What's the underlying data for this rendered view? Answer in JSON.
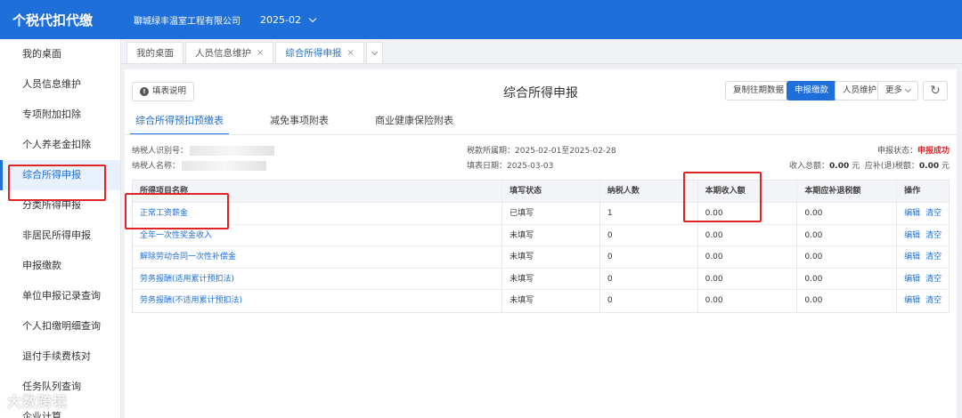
{
  "header": {
    "app_title": "个税代扣代缴",
    "company": "聊城绿丰温室工程有限公司",
    "period": "2025-02"
  },
  "sidebar": {
    "items": [
      {
        "label": "我的桌面"
      },
      {
        "label": "人员信息维护"
      },
      {
        "label": "专项附加扣除"
      },
      {
        "label": "个人养老金扣除"
      },
      {
        "label": "综合所得申报",
        "active": true
      },
      {
        "label": "分类所得申报"
      },
      {
        "label": "非居民所得申报"
      },
      {
        "label": "申报缴款"
      },
      {
        "label": "单位申报记录查询"
      },
      {
        "label": "个人扣缴明细查询"
      },
      {
        "label": "退付手续费核对"
      },
      {
        "label": "任务队列查询"
      },
      {
        "label": "企业计算"
      }
    ]
  },
  "watermark": "大数跨境",
  "page_tabs": [
    {
      "label": "我的桌面",
      "closable": false
    },
    {
      "label": "人员信息维护",
      "closable": true
    },
    {
      "label": "综合所得申报",
      "closable": true,
      "active": true
    }
  ],
  "toolbar": {
    "guide_label": "填表说明",
    "page_title": "综合所得申报",
    "copy_label": "复制往期数据",
    "declare_label": "申报缴款",
    "person_label": "人员维护",
    "more_label": "更多"
  },
  "sub_tabs": [
    {
      "label": "综合所得预扣预缴表",
      "active": true
    },
    {
      "label": "减免事项附表"
    },
    {
      "label": "商业健康保险附表"
    }
  ],
  "meta": {
    "taxpayer_id_label": "纳税人识别号：",
    "taxpayer_name_label": "纳税人名称：",
    "period_label": "税款所属期：",
    "period_value": "2025-02-01至2025-02-28",
    "fill_date_label": "填表日期：",
    "fill_date_value": "2025-03-03",
    "status_label": "申报状态：",
    "status_value": "申报成功",
    "income_total_label": "收入总额：",
    "income_total_value": "0.00",
    "tax_due_label": "应补(退)税额：",
    "tax_due_value": "0.00",
    "unit": "元"
  },
  "table": {
    "headers": [
      "所得项目名称",
      "填写状态",
      "纳税人数",
      "本期收入额",
      "本期应补退税额",
      "操作"
    ],
    "rows": [
      {
        "name": "正常工资薪金",
        "status": "已填写",
        "count": "1",
        "income": "0.00",
        "tax": "0.00"
      },
      {
        "name": "全年一次性奖金收入",
        "status": "未填写",
        "count": "0",
        "income": "0.00",
        "tax": "0.00"
      },
      {
        "name": "解除劳动合同一次性补偿金",
        "status": "未填写",
        "count": "0",
        "income": "0.00",
        "tax": "0.00"
      },
      {
        "name": "劳务报酬(适用累计预扣法)",
        "status": "未填写",
        "count": "0",
        "income": "0.00",
        "tax": "0.00"
      },
      {
        "name": "劳务报酬(不适用累计预扣法)",
        "status": "未填写",
        "count": "0",
        "income": "0.00",
        "tax": "0.00"
      }
    ],
    "edit_label": "编辑",
    "clear_label": "清空"
  }
}
